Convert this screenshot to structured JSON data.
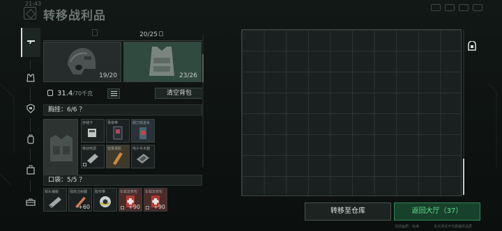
{
  "app": {
    "clock": "21:43",
    "title": "转移战利品"
  },
  "inventory": {
    "capacity_value": "20/25",
    "helmet": {
      "durability": "19/20",
      "icon": "helmet-icon"
    },
    "vest": {
      "durability": "23/26",
      "icon": "armor-vest-icon"
    },
    "weight_value": "31.4",
    "weight_unit": "/70千克",
    "clear_button": "清空背包",
    "chest_rig": {
      "header": "胸挂：6/6 ？",
      "items": [
        {
          "label": "存储卡",
          "count": ""
        },
        {
          "label": "录像带",
          "count": ""
        },
        {
          "label": "削刀伐道水",
          "count": ""
        },
        {
          "label": "移动电源",
          "count": ""
        },
        {
          "label": "能量凝胶",
          "count": ""
        },
        {
          "label": "电子手术器",
          "count": ""
        }
      ]
    },
    "pockets": {
      "header": "口袋：5/5 ？",
      "items": [
        {
          "label": "钳头锤搬",
          "count": ""
        },
        {
          "label": "强效注射器",
          "count": "+60"
        },
        {
          "label": "胶布带",
          "count": ""
        },
        {
          "label": "车载急救包",
          "count": "+90"
        },
        {
          "label": "车载急救包",
          "count": "+90"
        }
      ]
    }
  },
  "actions": {
    "transfer_button": "转移至仓库",
    "return_button": "返回大厅（37）"
  },
  "footer": {
    "left": "当前画质：标准",
    "right": "本次测试不代表最终品质"
  },
  "colors": {
    "accent_green": "#5fe28f",
    "panel_bg": "#1a201f",
    "vest_bg": "#314a40",
    "medkit_red": "#4a2b28"
  }
}
